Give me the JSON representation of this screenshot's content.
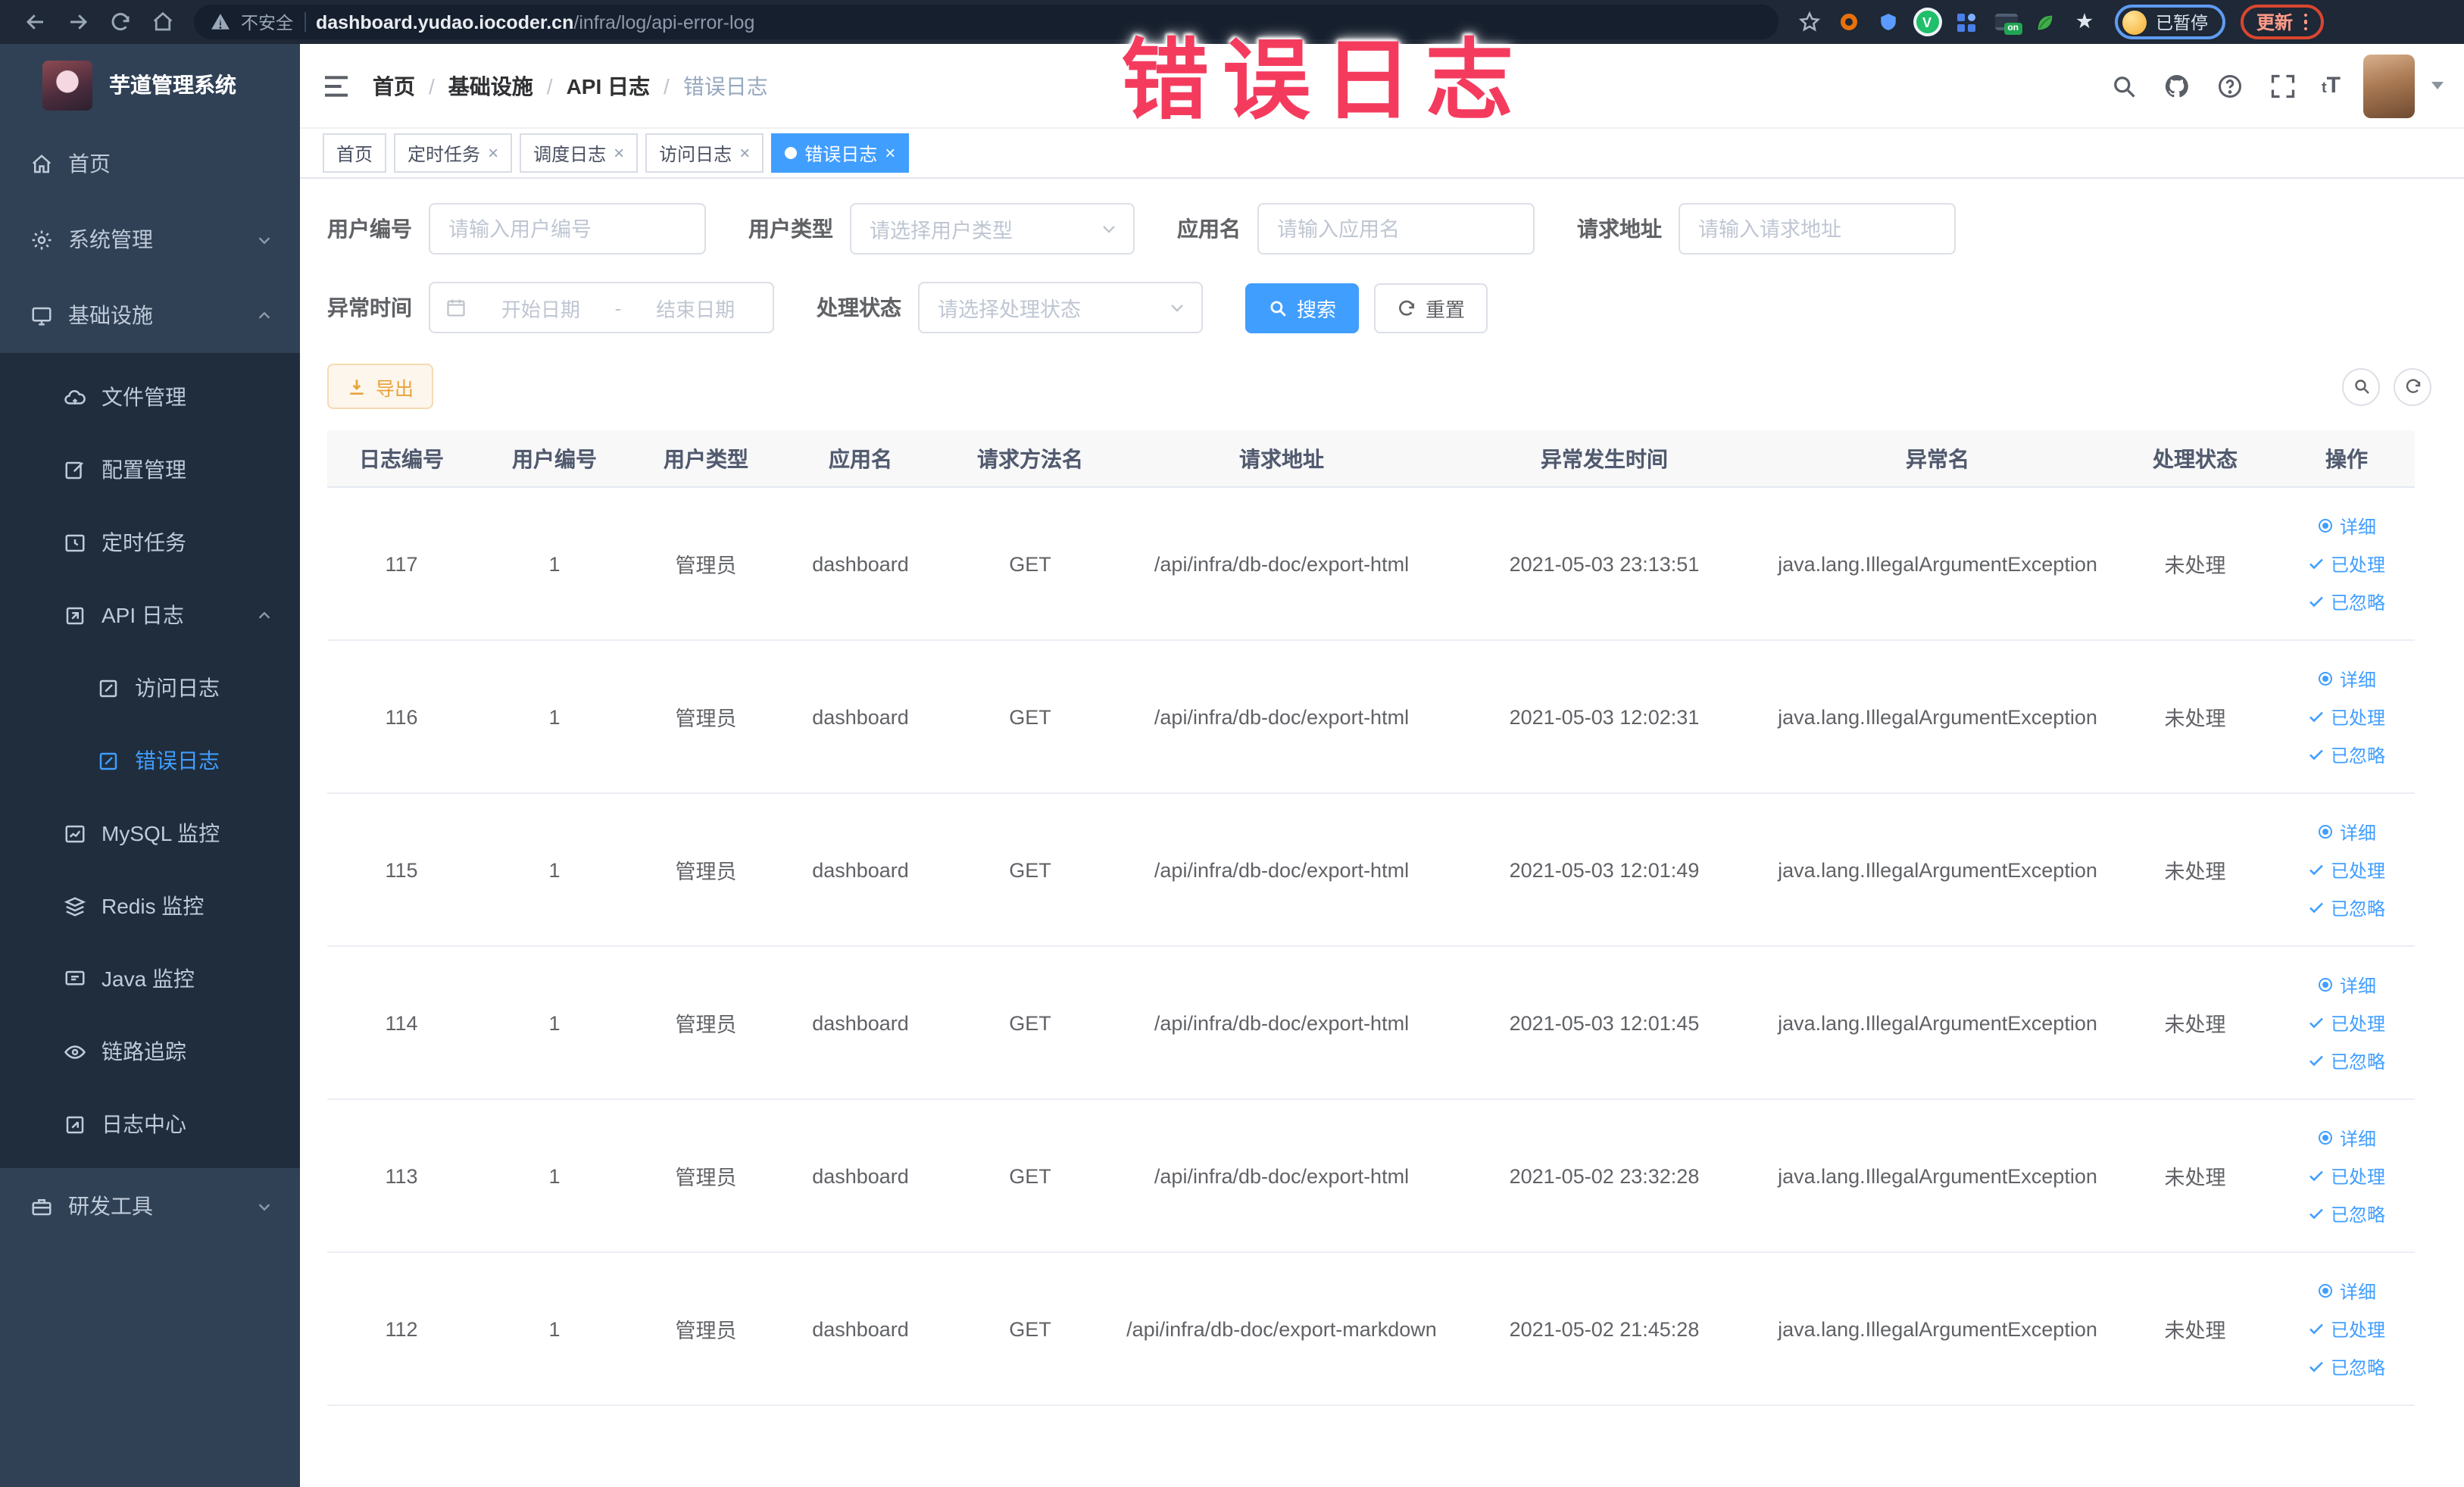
{
  "overlay": {
    "text": "错误日志"
  },
  "browser": {
    "security_label": "不安全",
    "url_domain": "dashboard.yudao.iocoder.cn",
    "url_path": "/infra/log/api-error-log",
    "profile_status": "已暂停",
    "update_label": "更新"
  },
  "sidebar": {
    "app_title": "芋道管理系统",
    "items": [
      {
        "label": "首页"
      },
      {
        "label": "系统管理"
      },
      {
        "label": "基础设施"
      },
      {
        "label": "文件管理"
      },
      {
        "label": "配置管理"
      },
      {
        "label": "定时任务"
      },
      {
        "label": "API 日志"
      },
      {
        "label": "访问日志"
      },
      {
        "label": "错误日志"
      },
      {
        "label": "MySQL 监控"
      },
      {
        "label": "Redis 监控"
      },
      {
        "label": "Java 监控"
      },
      {
        "label": "链路追踪"
      },
      {
        "label": "日志中心"
      },
      {
        "label": "研发工具"
      }
    ]
  },
  "breadcrumb": [
    "首页",
    "基础设施",
    "API 日志",
    "错误日志"
  ],
  "navbar": {
    "font_size_icon_text": "tT"
  },
  "tabs": [
    {
      "label": "首页"
    },
    {
      "label": "定时任务"
    },
    {
      "label": "调度日志"
    },
    {
      "label": "访问日志"
    },
    {
      "label": "错误日志"
    }
  ],
  "filters": {
    "user_id": {
      "label": "用户编号",
      "placeholder": "请输入用户编号"
    },
    "user_type": {
      "label": "用户类型",
      "placeholder": "请选择用户类型"
    },
    "app_name": {
      "label": "应用名",
      "placeholder": "请输入应用名"
    },
    "request_url": {
      "label": "请求地址",
      "placeholder": "请输入请求地址"
    },
    "time": {
      "label": "异常时间",
      "start_placeholder": "开始日期",
      "separator": "-",
      "end_placeholder": "结束日期"
    },
    "status": {
      "label": "处理状态",
      "placeholder": "请选择处理状态"
    },
    "search_label": "搜索",
    "reset_label": "重置"
  },
  "toolbar": {
    "export_label": "导出"
  },
  "table": {
    "columns": [
      "日志编号",
      "用户编号",
      "用户类型",
      "应用名",
      "请求方法名",
      "请求地址",
      "异常发生时间",
      "异常名",
      "处理状态",
      "操作"
    ],
    "actions": {
      "detail": "详细",
      "processed": "已处理",
      "ignored": "已忽略"
    },
    "rows": [
      {
        "id": "117",
        "user_id": "1",
        "user_type": "管理员",
        "app_name": "dashboard",
        "method": "GET",
        "url": "/api/infra/db-doc/export-html",
        "time": "2021-05-03 23:13:51",
        "exception": "java.lang.IllegalArgumentException",
        "status": "未处理"
      },
      {
        "id": "116",
        "user_id": "1",
        "user_type": "管理员",
        "app_name": "dashboard",
        "method": "GET",
        "url": "/api/infra/db-doc/export-html",
        "time": "2021-05-03 12:02:31",
        "exception": "java.lang.IllegalArgumentException",
        "status": "未处理"
      },
      {
        "id": "115",
        "user_id": "1",
        "user_type": "管理员",
        "app_name": "dashboard",
        "method": "GET",
        "url": "/api/infra/db-doc/export-html",
        "time": "2021-05-03 12:01:49",
        "exception": "java.lang.IllegalArgumentException",
        "status": "未处理"
      },
      {
        "id": "114",
        "user_id": "1",
        "user_type": "管理员",
        "app_name": "dashboard",
        "method": "GET",
        "url": "/api/infra/db-doc/export-html",
        "time": "2021-05-03 12:01:45",
        "exception": "java.lang.IllegalArgumentException",
        "status": "未处理"
      },
      {
        "id": "113",
        "user_id": "1",
        "user_type": "管理员",
        "app_name": "dashboard",
        "method": "GET",
        "url": "/api/infra/db-doc/export-html",
        "time": "2021-05-02 23:32:28",
        "exception": "java.lang.IllegalArgumentException",
        "status": "未处理"
      },
      {
        "id": "112",
        "user_id": "1",
        "user_type": "管理员",
        "app_name": "dashboard",
        "method": "GET",
        "url": "/api/infra/db-doc/export-markdown",
        "time": "2021-05-02 21:45:28",
        "exception": "java.lang.IllegalArgumentException",
        "status": "未处理"
      }
    ]
  },
  "colors": {
    "accent": "#409eff",
    "sidebar_bg": "#304156",
    "submenu_bg": "#1f2d3d",
    "warning": "#e6a23c",
    "overlay_text": "#f43b5e"
  }
}
